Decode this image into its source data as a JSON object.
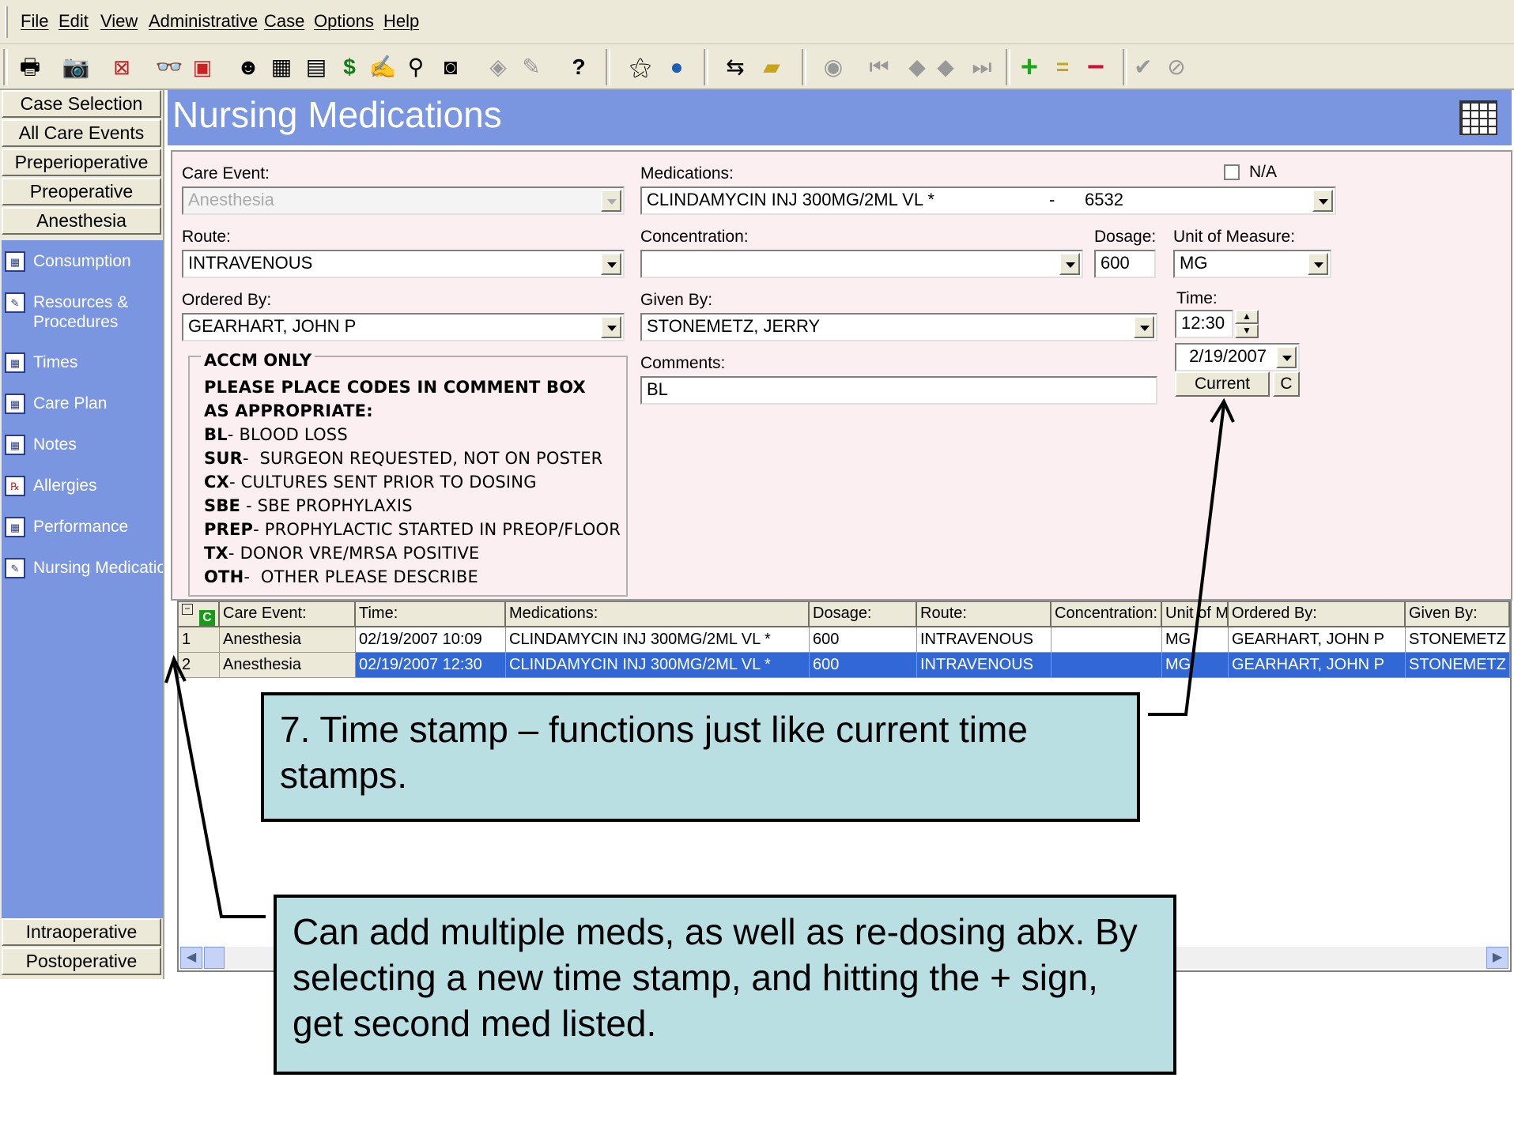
{
  "menu": [
    "File",
    "Edit",
    "View",
    "Administrative",
    "Case",
    "Options",
    "Help"
  ],
  "toolbar_icons": [
    "print-icon",
    "camera-icon",
    "cancel-case-icon",
    "glasses-icon",
    "report-icon",
    "patient-icon",
    "calculator-icon",
    "schedule-icon",
    "billing-icon",
    "sign-icon",
    "search-icon",
    "document-icon",
    "eraser-icon",
    "brush-icon",
    "help-icon",
    "wand-icon",
    "globe-icon",
    "user-swap-icon",
    "notepad-icon",
    "find-icon",
    "first-record-icon",
    "prev-record-icon",
    "next-record-icon",
    "last-record-icon",
    "add-icon",
    "equal-icon",
    "delete-icon",
    "check-icon",
    "cancel-icon"
  ],
  "colors": {
    "accent": "#7b96e0",
    "form_bg": "#fbeff2",
    "selected_row": "#3168d5",
    "callout_bg": "#b9dfe3",
    "add": "#1aa81a",
    "delete": "#d0103a"
  },
  "nav": {
    "top_buttons": [
      "Case Selection",
      "All Care Events",
      "Preperioperative",
      "Preoperative",
      "Anesthesia"
    ],
    "items": [
      "Consumption",
      "Resources & Procedures",
      "Times",
      "Care Plan",
      "Notes",
      "Allergies",
      "Performance",
      "Nursing Medications"
    ],
    "bottom_buttons": [
      "Intraoperative",
      "Postoperative"
    ]
  },
  "page_title": "Nursing Medications",
  "form": {
    "care_event_label": "Care Event:",
    "care_event_value": "Anesthesia",
    "medications_label": "Medications:",
    "medications_value": "CLINDAMYCIN INJ 300MG/2ML VL *",
    "medications_code": "6532",
    "na_label": "N/A",
    "route_label": "Route:",
    "route_value": "INTRAVENOUS",
    "concentration_label": "Concentration:",
    "concentration_value": "",
    "dosage_label": "Dosage:",
    "dosage_value": "600",
    "uom_label": "Unit of Measure:",
    "uom_value": "MG",
    "ordered_by_label": "Ordered By:",
    "ordered_by_value": "GEARHART, JOHN P",
    "given_by_label": "Given By:",
    "given_by_value": "STONEMETZ, JERRY",
    "time_label": "Time:",
    "time_value": "12:30",
    "date_value": "2/19/2007",
    "current_button": "Current",
    "c_button": "C",
    "comments_label": "Comments:",
    "comments_value": "BL"
  },
  "info_box": {
    "legend": "ACCM ONLY",
    "heading1": "PLEASE PLACE CODES IN COMMENT BOX",
    "heading2": "AS APPROPRIATE:",
    "codes": [
      {
        "code": "BL",
        "sep": "- ",
        "desc": "BLOOD LOSS"
      },
      {
        "code": "SUR",
        "sep": "-  ",
        "desc": "SURGEON REQUESTED, NOT ON POSTER"
      },
      {
        "code": "CX",
        "sep": "- ",
        "desc": "CULTURES SENT PRIOR TO DOSING"
      },
      {
        "code": "SBE",
        "sep": " - ",
        "desc": "SBE PROPHYLAXIS"
      },
      {
        "code": "PREP",
        "sep": "- ",
        "desc": "PROPHYLACTIC STARTED IN PREOP/FLOOR"
      },
      {
        "code": "TX",
        "sep": "- ",
        "desc": "DONOR VRE/MRSA POSITIVE"
      },
      {
        "code": "OTH",
        "sep": "-  ",
        "desc": "OTHER PLEASE DESCRIBE"
      }
    ]
  },
  "grid": {
    "headers": [
      "Care Event:",
      "Time:",
      "Medications:",
      "Dosage:",
      "Route:",
      "Concentration:",
      "Unit of M",
      "Ordered By:",
      "Given By:"
    ],
    "rows": [
      {
        "num": "1",
        "cells": [
          "Anesthesia",
          "02/19/2007 10:09",
          "CLINDAMYCIN INJ 300MG/2ML VL *",
          "600",
          "INTRAVENOUS",
          "",
          "MG",
          "GEARHART, JOHN P",
          "STONEMETZ"
        ]
      },
      {
        "num": "2",
        "cells": [
          "Anesthesia",
          "02/19/2007 12:30",
          "CLINDAMYCIN INJ 300MG/2ML VL *",
          "600",
          "INTRAVENOUS",
          "",
          "MG",
          "GEARHART, JOHN P",
          "STONEMETZ"
        ]
      }
    ]
  },
  "callouts": {
    "time_stamp": "7. Time stamp – functions just like current time stamps.",
    "multiple_meds": "Can add multiple meds, as well as re-dosing abx. By selecting a new time stamp, and hitting the + sign, get second med listed."
  }
}
